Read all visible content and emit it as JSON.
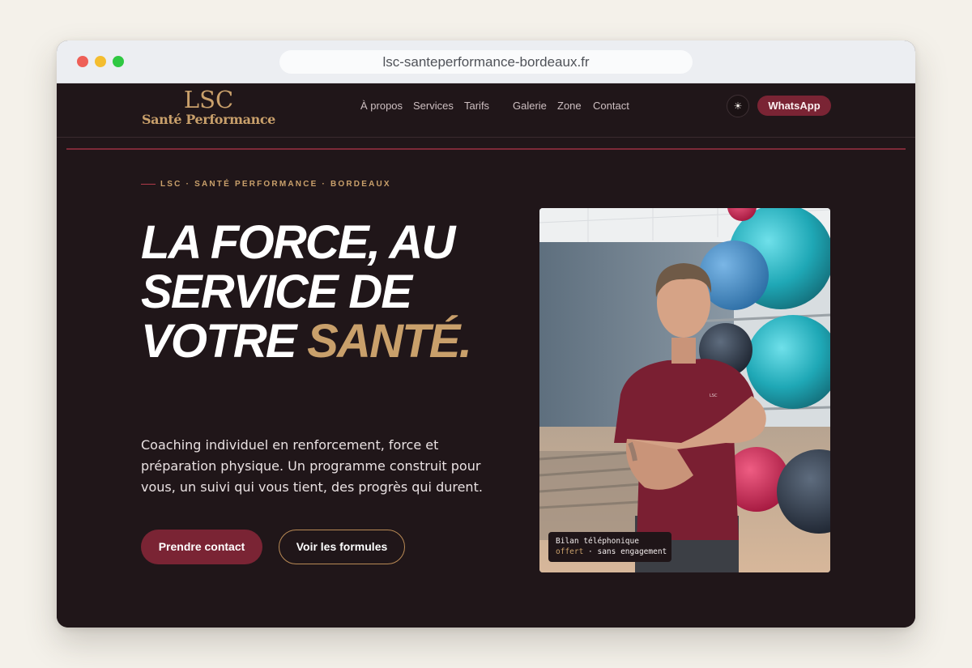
{
  "browser": {
    "url": "lsc-santeperformance-bordeaux.fr"
  },
  "nav": {
    "logo_main": "LSC",
    "logo_sub": "Santé Performance",
    "links": [
      "À propos",
      "Services",
      "Tarifs",
      "Galerie",
      "Zone",
      "Contact"
    ],
    "theme_icon": "sun-icon",
    "theme_glyph": "☀",
    "whatsapp_label": "WhatsApp"
  },
  "hero": {
    "eyebrow": "LSC · SANTÉ PERFORMANCE · BORDEAUX",
    "headline_line1": "LA FORCE, AU",
    "headline_line2": "SERVICE DE",
    "headline_line3_white": "VOTRE ",
    "headline_line3_gold": "SANTÉ.",
    "lede": "Coaching individuel en renforcement, force et préparation physique. Un programme construit pour vous, un suivi qui vous tient, des progrès qui durent.",
    "cta_primary": "Prendre contact",
    "cta_secondary": "Voir les formules"
  },
  "photo": {
    "shirt_logo": "LSC",
    "badge_line1": "Bilan téléphonique",
    "badge_accent": "offert",
    "badge_rest": " · sans engagement"
  },
  "colors": {
    "background": "#201619",
    "accent_burgundy": "#7a2434",
    "accent_gold": "#c9a06b"
  }
}
